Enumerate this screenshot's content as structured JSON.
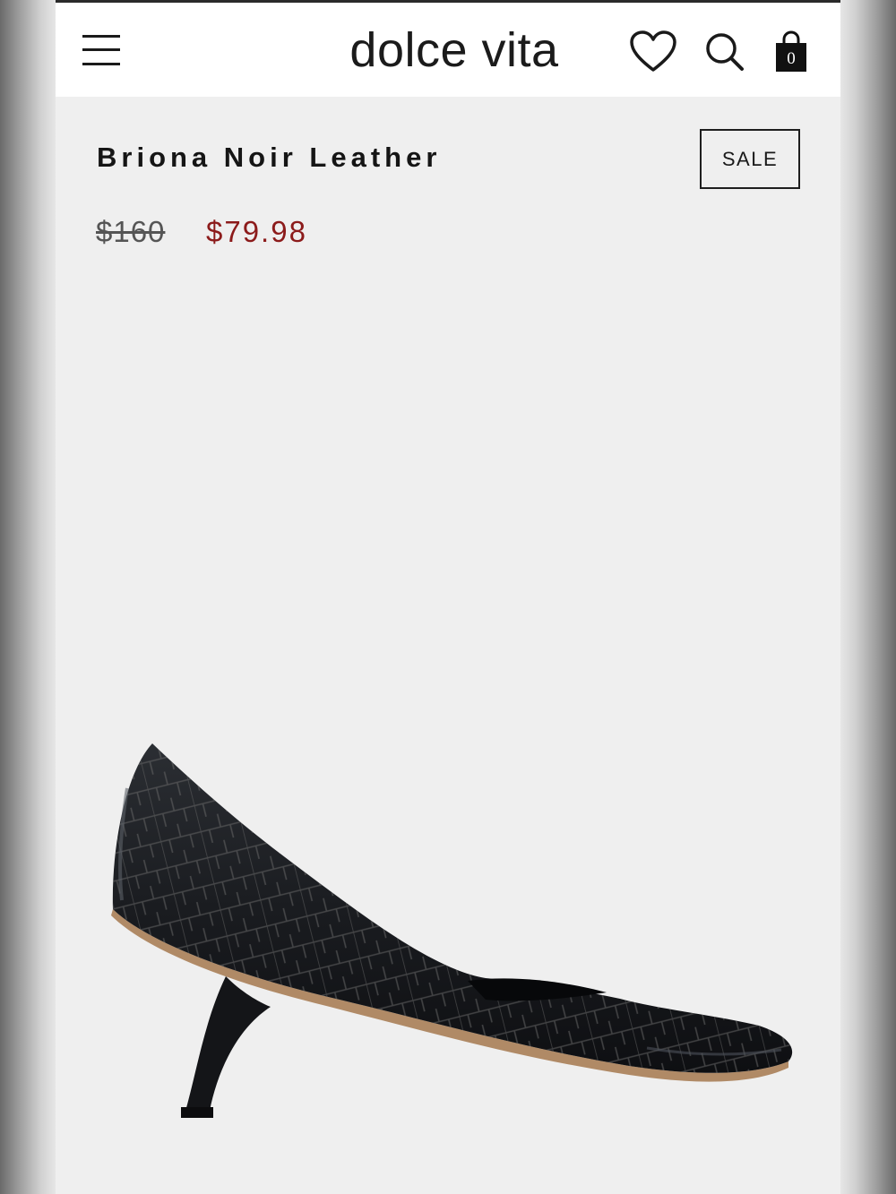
{
  "header": {
    "brand": "dolce vita",
    "menu_icon": "hamburger-menu-icon",
    "wishlist_icon": "heart-icon",
    "search_icon": "search-icon",
    "cart_icon": "shopping-bag-icon",
    "cart_count": "0"
  },
  "product": {
    "name": "Briona Noir Leather",
    "badge": "SALE",
    "original_price": "$160",
    "sale_price": "$79.98",
    "image": "black-croc-embossed-pump"
  },
  "colors": {
    "sale_price": "#8c1b1b",
    "background": "#efefef",
    "header": "#ffffff"
  }
}
